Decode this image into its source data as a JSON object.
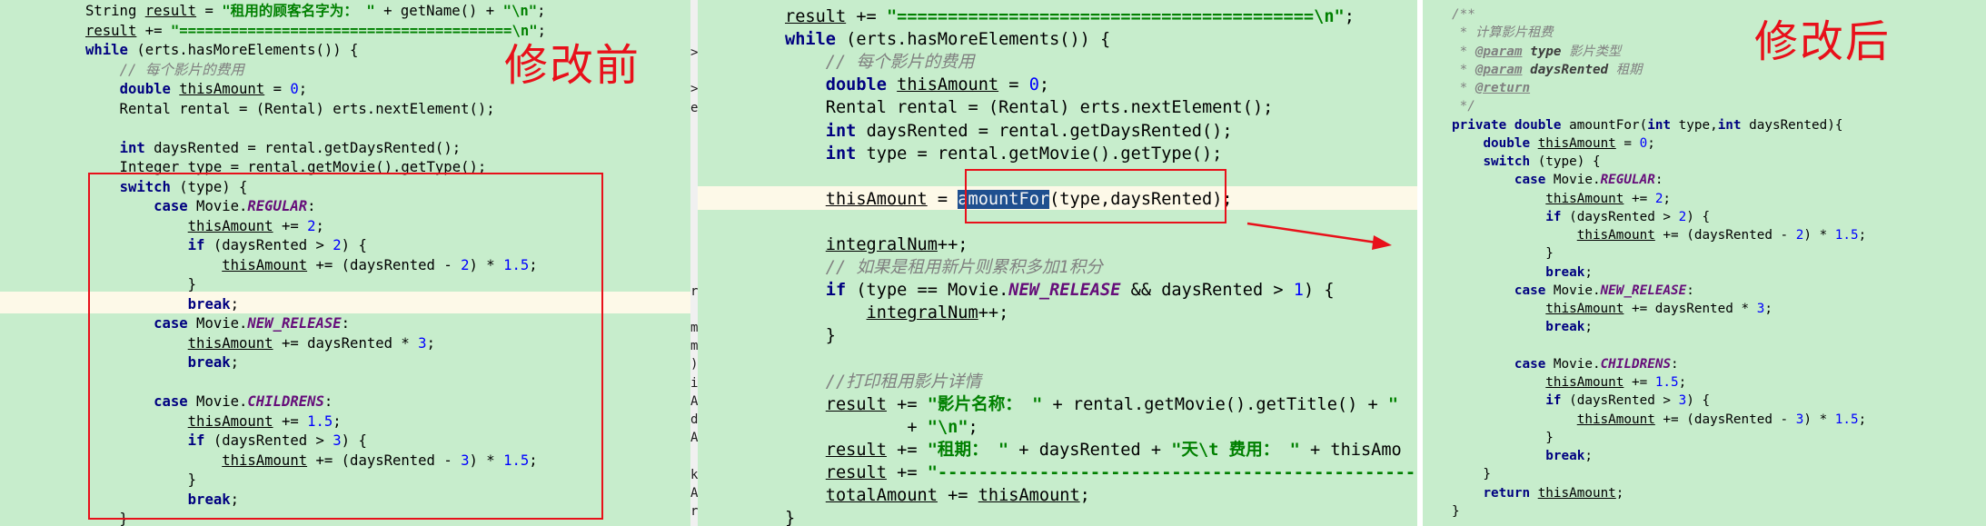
{
  "before": {
    "label": "修改前",
    "lines": [
      "String result = \"租用的顾客名字为： \" + getName() + \"\\n\";",
      "result += \"=======================================\\n\";",
      "while (erts.hasMoreElements()) {",
      "    // 每个影片的费用",
      "    double thisAmount = 0;",
      "    Rental rental = (Rental) erts.nextElement();",
      "",
      "    int daysRented = rental.getDaysRented();",
      "    Integer type = rental.getMovie().getType();",
      "    switch (type) {",
      "        case Movie.REGULAR:",
      "            thisAmount += 2;",
      "            if (daysRented > 2) {",
      "                thisAmount += (daysRented - 2) * 1.5;",
      "            }",
      "            break;",
      "        case Movie.NEW_RELEASE:",
      "            thisAmount += daysRented * 3;",
      "            break;",
      "",
      "        case Movie.CHILDRENS:",
      "            thisAmount += 1.5;",
      "            if (daysRented > 3) {",
      "                thisAmount += (daysRented - 3) * 1.5;",
      "            }",
      "            break;",
      "    }"
    ]
  },
  "during": {
    "lines": [
      "result += \"=========================================\\n\";",
      "while (erts.hasMoreElements()) {",
      "    // 每个影片的费用",
      "    double thisAmount = 0;",
      "    Rental rental = (Rental) erts.nextElement();",
      "    int daysRented = rental.getDaysRented();",
      "    int type = rental.getMovie().getType();",
      "",
      "    thisAmount = amountFor(type,daysRented);",
      "",
      "    integralNum++;",
      "    // 如果是租用新片则累积多加1积分",
      "    if (type == Movie.NEW_RELEASE && daysRented > 1) {",
      "        integralNum++;",
      "    }",
      "",
      "    //打印租用影片详情",
      "    result += \"影片名称： \" + rental.getMovie().getTitle() + \"",
      "            + \"\\n\";",
      "    result += \"租期： \" + daysRented + \"天\\t 费用： \" + thisAmo",
      "    result += \"--------------------------------------------------",
      "    totalAmount += thisAmount;",
      "}"
    ],
    "gutter_chars": [
      ">",
      "",
      ">",
      "e",
      "",
      "",
      "",
      "",
      "",
      "",
      "",
      "",
      "",
      "r",
      "",
      "m",
      "m",
      ")",
      "i",
      "A",
      "d",
      "A",
      "",
      "k",
      "A",
      "r"
    ]
  },
  "after": {
    "label": "修改后",
    "lines": [
      "/**",
      " * 计算影片租费",
      " * @param type 影片类型",
      " * @param daysRented 租期",
      " * @return",
      " */",
      "private double amountFor(int type,int daysRented){",
      "    double thisAmount = 0;",
      "    switch (type) {",
      "        case Movie.REGULAR:",
      "            thisAmount += 2;",
      "            if (daysRented > 2) {",
      "                thisAmount += (daysRented - 2) * 1.5;",
      "            }",
      "            break;",
      "        case Movie.NEW_RELEASE:",
      "            thisAmount += daysRented * 3;",
      "            break;",
      "",
      "        case Movie.CHILDRENS:",
      "            thisAmount += 1.5;",
      "            if (daysRented > 3) {",
      "                thisAmount += (daysRented - 3) * 1.5;",
      "            }",
      "            break;",
      "    }",
      "    return thisAmount;",
      "}"
    ]
  },
  "colors": {
    "editor_bg": "#c7edcc",
    "annotation_red": "#e8101a",
    "keyword": "#000080",
    "number": "#0000ff",
    "string": "#008000",
    "comment": "#808080",
    "field": "#660e7a"
  }
}
